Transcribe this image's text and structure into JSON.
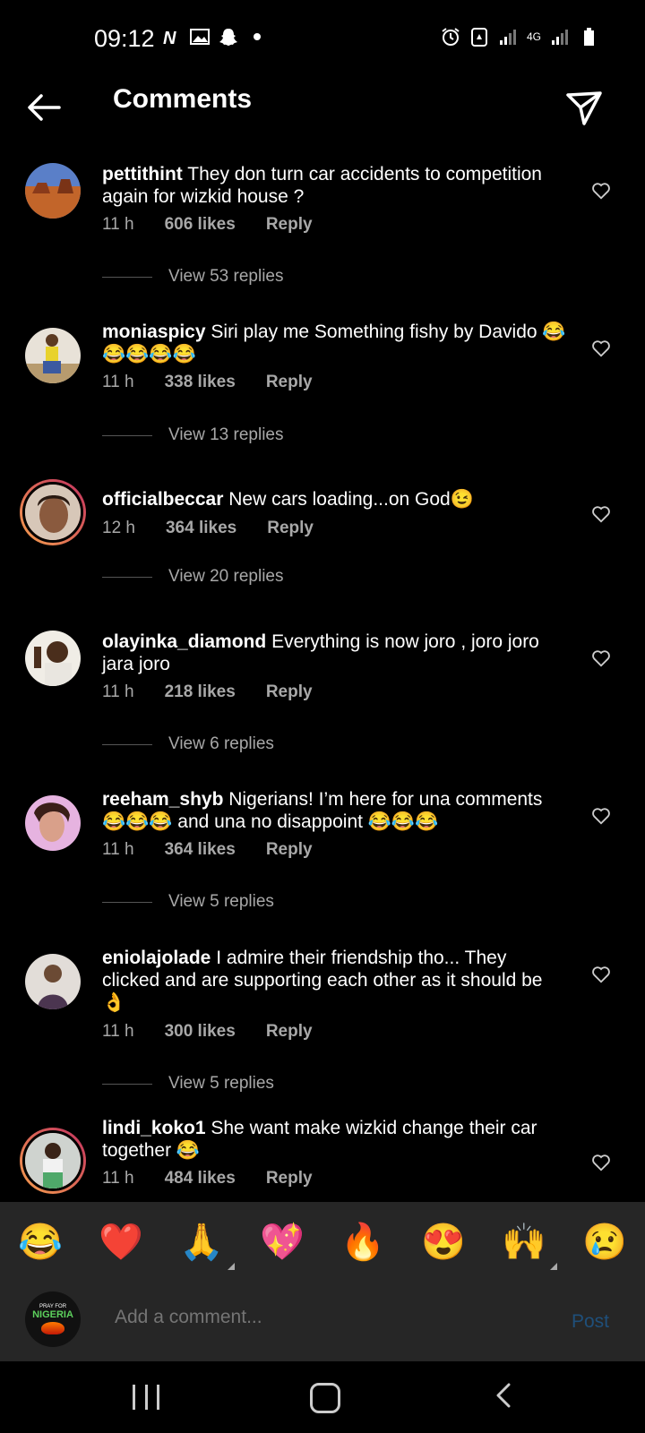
{
  "status_bar": {
    "time": "09:12",
    "network_label": "4G"
  },
  "header": {
    "title": "Comments"
  },
  "comments": [
    {
      "username": "pettithint",
      "text": "They don turn car accidents to competition again for wizkid house ?",
      "time": "11 h",
      "likes": "606 likes",
      "reply": "Reply",
      "view_replies": "View 53 replies"
    },
    {
      "username": "moniaspicy",
      "text": "Siri play me Something fishy by Davido 😂😂😂😂😂",
      "time": "11 h",
      "likes": "338 likes",
      "reply": "Reply",
      "view_replies": "View 13 replies"
    },
    {
      "username": "officialbeccar",
      "text": "New cars loading...on God😉",
      "time": "12 h",
      "likes": "364 likes",
      "reply": "Reply",
      "view_replies": "View 20 replies"
    },
    {
      "username": "olayinka_diamond",
      "text": "Everything is now joro , joro joro jara joro",
      "time": "11 h",
      "likes": "218 likes",
      "reply": "Reply",
      "view_replies": "View 6 replies"
    },
    {
      "username": "reeham_shyb",
      "text": "Nigerians! I’m here for una comments 😂😂😂 and una no disappoint 😂😂😂",
      "time": "11 h",
      "likes": "364 likes",
      "reply": "Reply",
      "view_replies": "View 5 replies"
    },
    {
      "username": "eniolajolade",
      "text": "I admire their friendship tho... They clicked and are supporting each other as it should be 👌",
      "time": "11 h",
      "likes": "300 likes",
      "reply": "Reply",
      "view_replies": "View 5 replies"
    },
    {
      "username": "lindi_koko1",
      "text": "She want make wizkid change their car together 😂",
      "time": "11 h",
      "likes": "484 likes",
      "reply": "Reply"
    }
  ],
  "emoji_bar": [
    "😂",
    "❤️",
    "🙏",
    "💖",
    "🔥",
    "😍",
    "🙌",
    "😢"
  ],
  "input": {
    "placeholder": "Add a comment...",
    "post_label": "Post"
  },
  "my_avatar": {
    "line1": "PRAY FOR",
    "line2": "NIGERIA"
  },
  "colors": {
    "background": "#000000",
    "secondary_text": "#a8a8a8",
    "post_button": "#1f4f7a",
    "bar_background": "#262626"
  }
}
